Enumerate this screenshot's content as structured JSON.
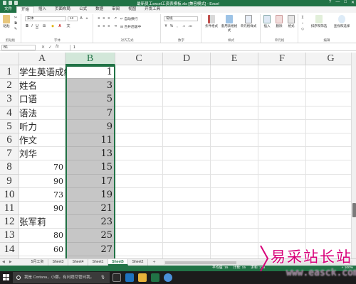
{
  "window": {
    "title": "最新员工excel工资表模板.xls [兼容模式] - Excel",
    "controls": [
      "?",
      "—",
      "□",
      "✕"
    ]
  },
  "ribbon": {
    "tabs": [
      "文件",
      "开始",
      "插入",
      "页面布局",
      "公式",
      "数据",
      "审阅",
      "视图",
      "开发工具"
    ],
    "active_tab": "开始",
    "groups": {
      "clipboard": "剪贴板",
      "font": "字体",
      "alignment": "对齐方式",
      "number": "数字",
      "styles": "样式",
      "cells": "单元格",
      "editing": "编辑"
    },
    "font_name": "宋体",
    "font_size": "12",
    "wrap_text": "自动换行",
    "merge_center": "合并后居中",
    "number_format": "常规",
    "paste": "粘贴",
    "conditional_format": "条件格式",
    "table_format": "套用表格格式",
    "cell_styles": "单元格样式",
    "insert": "插入",
    "delete": "删除",
    "format": "格式",
    "sort_filter": "排序和筛选",
    "find_select": "查找和选择"
  },
  "formula_bar": {
    "name_box": "B1",
    "fx": "fx",
    "content": "1"
  },
  "columns": [
    "A",
    "B",
    "C",
    "D",
    "E",
    "F",
    "G"
  ],
  "rows": [
    {
      "n": "1",
      "a": "学生英语成绩",
      "b": "1"
    },
    {
      "n": "2",
      "a": "姓名",
      "b": "3"
    },
    {
      "n": "3",
      "a": "口语",
      "b": "5"
    },
    {
      "n": "4",
      "a": "语法",
      "b": "7"
    },
    {
      "n": "5",
      "a": "听力",
      "b": "9"
    },
    {
      "n": "6",
      "a": "作文",
      "b": "11"
    },
    {
      "n": "7",
      "a": "刘华",
      "b": "13"
    },
    {
      "n": "8",
      "a_num": "70",
      "b": "15"
    },
    {
      "n": "9",
      "a_num": "90",
      "b": "17"
    },
    {
      "n": "10",
      "a_num": "73",
      "b": "19"
    },
    {
      "n": "11",
      "a_num": "90",
      "b": "21"
    },
    {
      "n": "12",
      "a": "张军莉",
      "b": "23"
    },
    {
      "n": "13",
      "a_num": "80",
      "b": "25"
    },
    {
      "n": "14",
      "a_num": "60",
      "b": "27"
    },
    {
      "n": "15",
      "a_num": "75",
      "b": "29"
    }
  ],
  "sheets": {
    "tabs": [
      "5月工资",
      "Sheet3",
      "Sheet4",
      "Sheet1",
      "Sheet5",
      "Sheet2"
    ],
    "active": "Sheet5",
    "add": "+"
  },
  "status_bar": {
    "average": "平均值: 15",
    "count": "计数: 15",
    "sum": "求和: 225",
    "zoom": "+ 100%"
  },
  "taskbar": {
    "search_placeholder": "我是 Cortana，小娜。有问题尽管问我。"
  },
  "watermark": {
    "line1": "易采站长站",
    "line2": "www.easck.com"
  },
  "colors": {
    "excel_green": "#217346",
    "selection_fill": "#c6c6c6",
    "watermark_pink": "#d8007a"
  }
}
